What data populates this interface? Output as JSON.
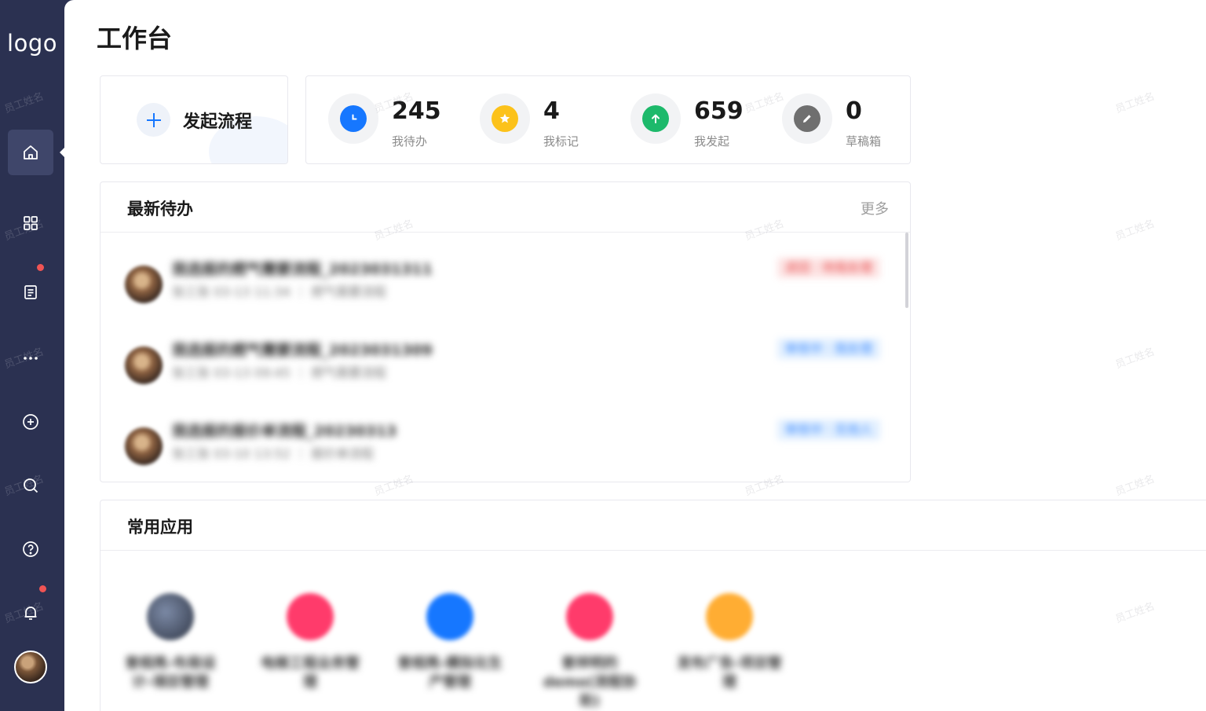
{
  "sidebar": {
    "logo": "logo",
    "items": [
      {
        "name": "home-icon"
      },
      {
        "name": "apps-grid-icon"
      },
      {
        "name": "document-icon"
      },
      {
        "name": "more-icon"
      },
      {
        "name": "add-circle-icon"
      },
      {
        "name": "search-icon"
      },
      {
        "name": "help-icon"
      },
      {
        "name": "bell-icon"
      }
    ]
  },
  "page": {
    "title": "工作台"
  },
  "start": {
    "label": "发起流程"
  },
  "stats": [
    {
      "value": "245",
      "label": "我待办",
      "color": "#1677ff",
      "icon": "clock-icon"
    },
    {
      "value": "4",
      "label": "我标记",
      "color": "#fcc21b",
      "icon": "star-icon"
    },
    {
      "value": "659",
      "label": "我发起",
      "color": "#1db96b",
      "icon": "arrow-up-icon"
    },
    {
      "value": "0",
      "label": "草稿箱",
      "color": "#6f6f6f",
      "icon": "pencil-icon"
    }
  ],
  "todos": {
    "title": "最新待办",
    "more": "更多",
    "rows": [
      {
        "title": "我选报的燃气需要流程_2023031311",
        "sub": "张三张  03-13 11:34  ｜  燃气需要流程",
        "tags": "退回  ·  待我处理",
        "tag_color": "red"
      },
      {
        "title": "我选报的燃气需要流程_2023031309",
        "sub": "张三张  03-13 09:45  ｜  燃气需要流程",
        "tags": "审核中  ·  我处理",
        "tag_color": "blue"
      },
      {
        "title": "我选报的报价单流程_20230313",
        "sub": "张三张  03-10 13:52  ｜  报价单流程",
        "tags": "审核中  ·  无他人",
        "tag_color": "blue"
      }
    ]
  },
  "apps": {
    "title": "常用应用",
    "items": [
      {
        "name": "曾相亮-布局设计-項目管理",
        "color": "#3b4457"
      },
      {
        "name": "电梯工程业务管理",
        "color": "#ff3b6b"
      },
      {
        "name": "曾相亮-模拟化生产管理",
        "color": "#1677ff"
      },
      {
        "name": "曾祥明的demo(流程协助)",
        "color": "#ff3b6b"
      },
      {
        "name": "发布广告-项目管理",
        "color": "#ffad33"
      }
    ]
  },
  "watermark": "员工姓名"
}
